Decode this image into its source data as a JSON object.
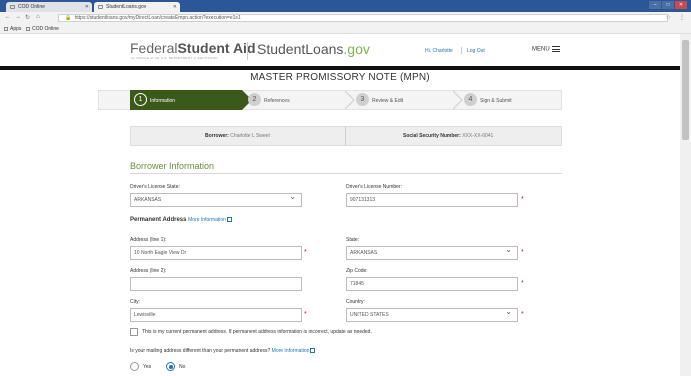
{
  "browser": {
    "tabs": [
      {
        "label": "COD Online"
      },
      {
        "label": "StudentLoans.gov"
      }
    ],
    "url": "https://studentloans.gov/myDirectLoan/createEmpn.action?execution=e1s1",
    "bookmarks": [
      {
        "label": "Apps"
      },
      {
        "label": "COD Online"
      }
    ]
  },
  "header": {
    "logo_fsa_light": "Federal",
    "logo_fsa_bold": "Student Aid",
    "logo_fsa_sub": "An OFFICE of the U.S. DEPARTMENT of EDUCATION",
    "logo_sl_main": "StudentLoans",
    "logo_sl_gov": ".gov",
    "greeting": "Hi, Charlotte",
    "logout": "Log Out",
    "menu": "MENU"
  },
  "page_title": "MASTER PROMISSORY NOTE (MPN)",
  "steps": [
    {
      "num": "1",
      "label": "Information"
    },
    {
      "num": "2",
      "label": "References"
    },
    {
      "num": "3",
      "label": "Review & Edit"
    },
    {
      "num": "4",
      "label": "Sign & Submit"
    }
  ],
  "borrower_strip": {
    "borrower_label": "Borrower:",
    "borrower_value": "Charlotte L Sweet",
    "ssn_label": "Social Security Number:",
    "ssn_value": "XXX-XX-6041"
  },
  "section_title": "Borrower Information",
  "form": {
    "dl_state_label": "Driver's License State:",
    "dl_state_value": "ARKANSAS",
    "dl_number_label": "Driver's License Number:",
    "dl_number_value": "907131313",
    "perm_address_label": "Permanent Address",
    "more_info": "More Information",
    "addr1_label": "Address (line 1):",
    "addr1_value": "10 North Eagle View Dr",
    "state_label": "State:",
    "state_value": "ARKANSAS",
    "addr2_label": "Address (line 2):",
    "addr2_value": "",
    "zip_label": "Zip Code:",
    "zip_value": "71845",
    "city_label": "City:",
    "city_value": "Lewisville",
    "country_label": "Country:",
    "country_value": "UNITED STATES",
    "req_mark": "*",
    "current_addr_check": "This is my current permanent address. If permanent address information is incorrect, update as needed.",
    "mailing_question": "Is your mailing address different than your permanent address?",
    "yes": "Yes",
    "no": "No"
  }
}
